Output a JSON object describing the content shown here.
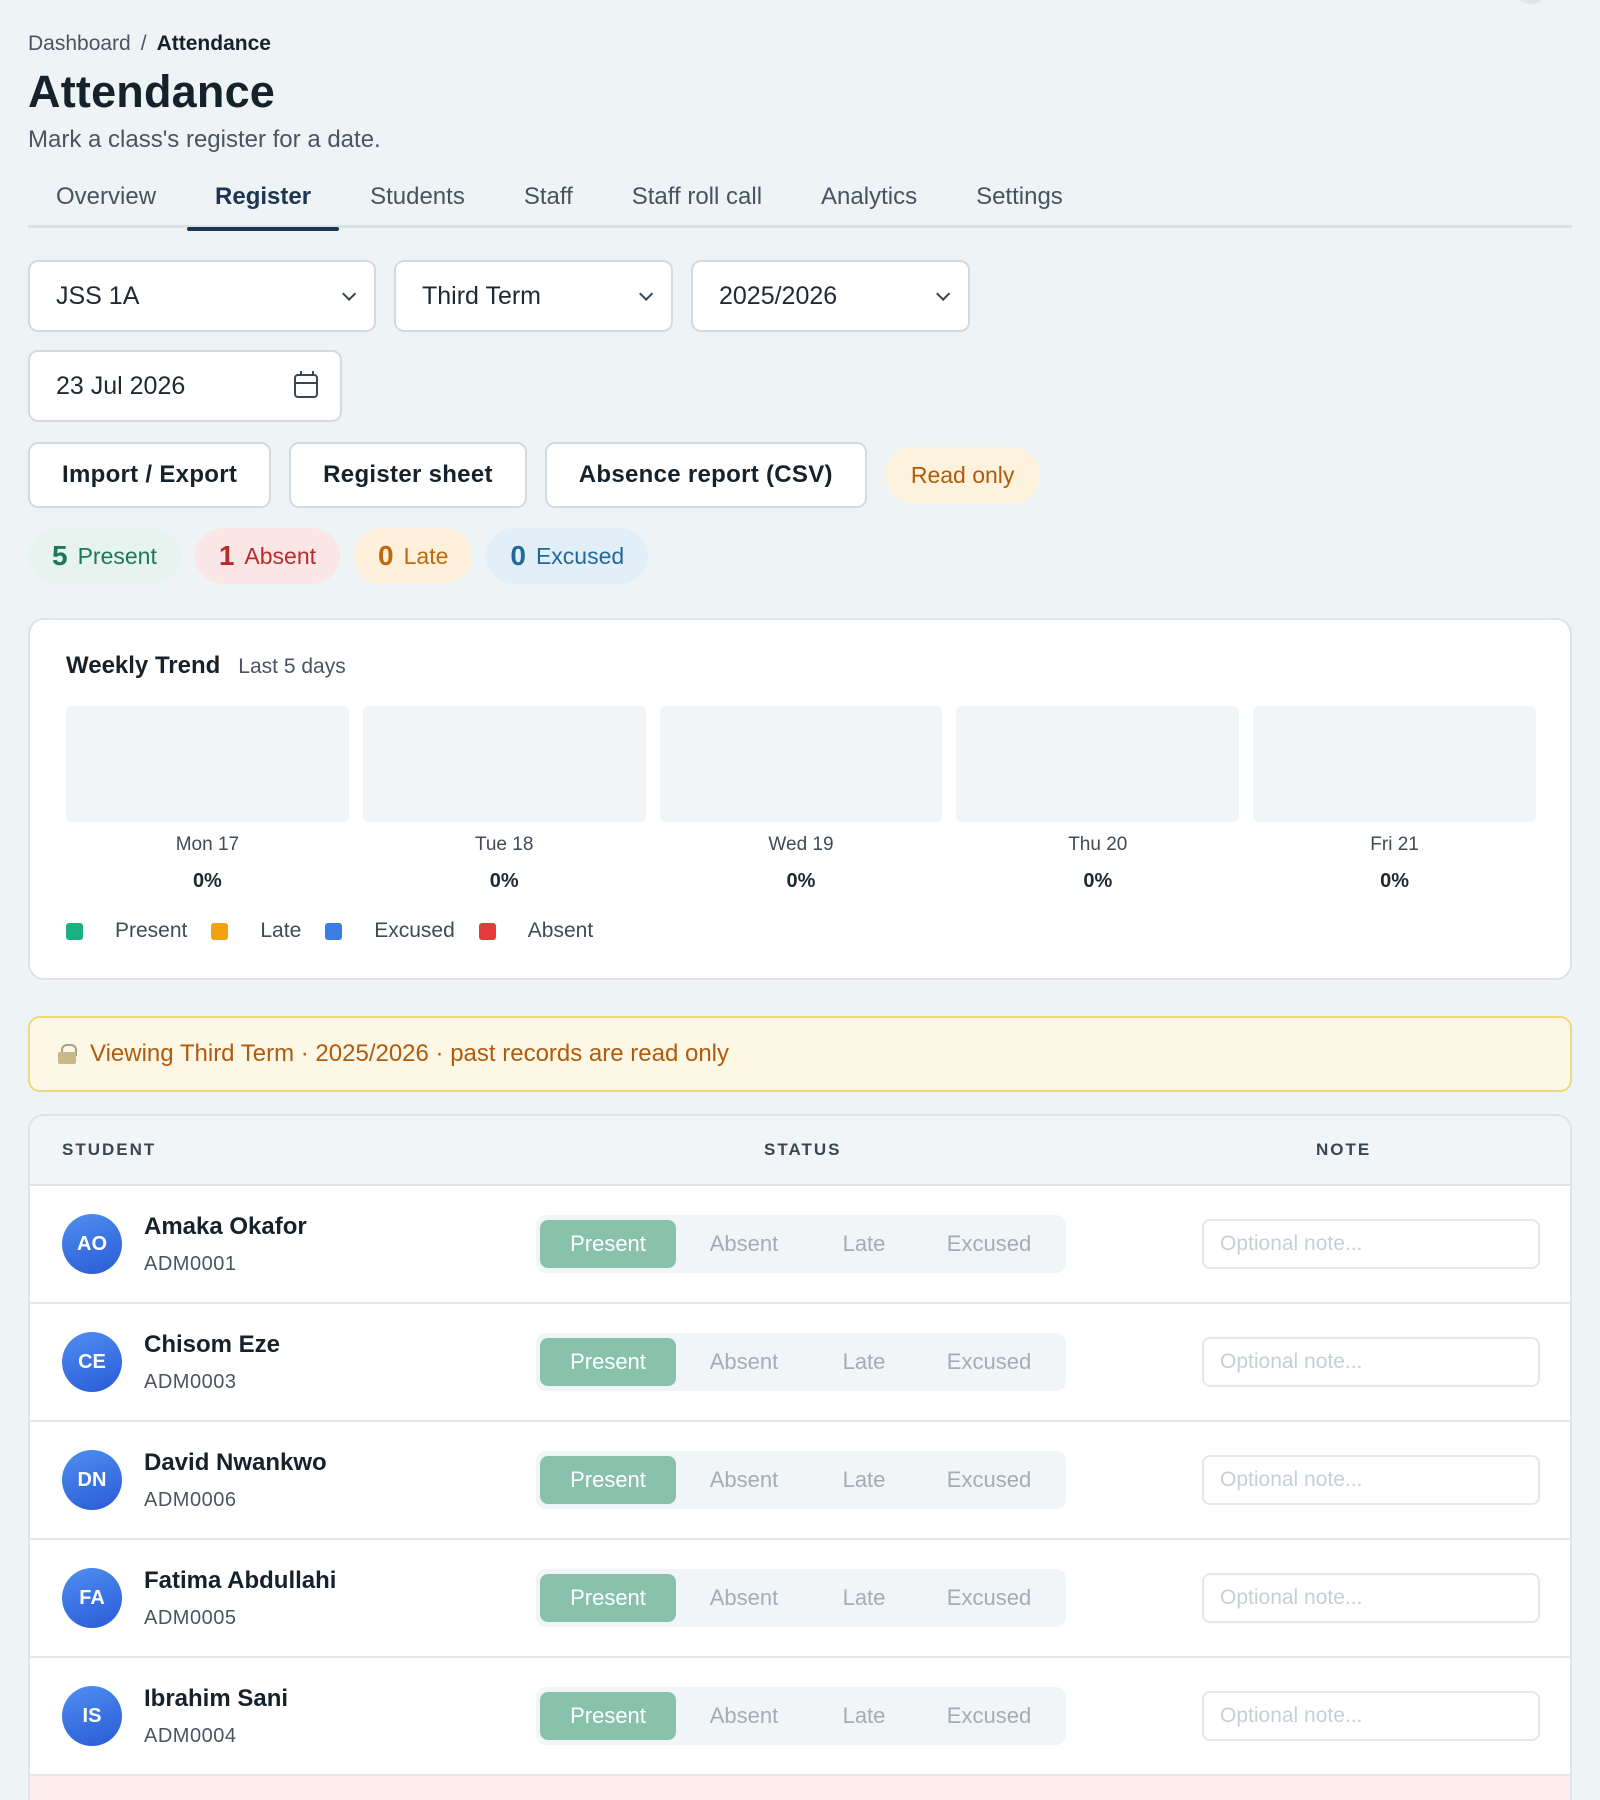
{
  "breadcrumb": {
    "parent": "Dashboard",
    "separator": "/",
    "current": "Attendance"
  },
  "page": {
    "title": "Attendance",
    "subtitle": "Mark a class's register for a date."
  },
  "tabs": [
    {
      "label": "Overview",
      "active": false
    },
    {
      "label": "Register",
      "active": true
    },
    {
      "label": "Students",
      "active": false
    },
    {
      "label": "Staff",
      "active": false
    },
    {
      "label": "Staff roll call",
      "active": false
    },
    {
      "label": "Analytics",
      "active": false
    },
    {
      "label": "Settings",
      "active": false
    }
  ],
  "filters": {
    "class": "JSS 1A",
    "term": "Third Term",
    "session": "2025/2026",
    "date": "23 Jul 2026"
  },
  "actions": {
    "import_export": "Import / Export",
    "register_sheet": "Register sheet",
    "absence_report": "Absence report (CSV)",
    "read_only_badge": "Read only"
  },
  "stats": [
    {
      "count": "5",
      "label": "Present",
      "kind": "present"
    },
    {
      "count": "1",
      "label": "Absent",
      "kind": "absent"
    },
    {
      "count": "0",
      "label": "Late",
      "kind": "late"
    },
    {
      "count": "0",
      "label": "Excused",
      "kind": "excused"
    }
  ],
  "weekly_trend": {
    "title": "Weekly Trend",
    "subtitle": "Last 5 days",
    "days": [
      {
        "label": "Mon 17",
        "pct": "0%"
      },
      {
        "label": "Tue 18",
        "pct": "0%"
      },
      {
        "label": "Wed 19",
        "pct": "0%"
      },
      {
        "label": "Thu 20",
        "pct": "0%"
      },
      {
        "label": "Fri 21",
        "pct": "0%"
      }
    ],
    "legend": [
      {
        "label": "Present",
        "color": "#1bb07f"
      },
      {
        "label": "Late",
        "color": "#f2a20f"
      },
      {
        "label": "Excused",
        "color": "#3a7de6"
      },
      {
        "label": "Absent",
        "color": "#e53b3b"
      }
    ]
  },
  "notice": {
    "icon": "lock-icon",
    "text": "Viewing Third Term · 2025/2026 · past records are read only"
  },
  "table": {
    "headers": {
      "student": "STUDENT",
      "status": "STATUS",
      "note": "NOTE"
    },
    "status_options": [
      "Present",
      "Absent",
      "Late",
      "Excused"
    ],
    "note_placeholder": "Optional note...",
    "rows": [
      {
        "initials": "AO",
        "name": "Amaka Okafor",
        "id": "ADM0001",
        "status": "Present"
      },
      {
        "initials": "CE",
        "name": "Chisom Eze",
        "id": "ADM0003",
        "status": "Present"
      },
      {
        "initials": "DN",
        "name": "David Nwankwo",
        "id": "ADM0006",
        "status": "Present"
      },
      {
        "initials": "FA",
        "name": "Fatima Abdullahi",
        "id": "ADM0005",
        "status": "Present"
      },
      {
        "initials": "IS",
        "name": "Ibrahim Sani",
        "id": "ADM0004",
        "status": "Present"
      }
    ]
  }
}
